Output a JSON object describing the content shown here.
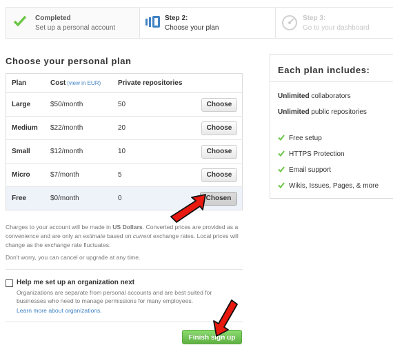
{
  "steps": [
    {
      "title": "Completed",
      "subtitle": "Set up a personal account",
      "icon": "check-icon"
    },
    {
      "title": "Step 2:",
      "subtitle": "Choose your plan",
      "icon": "book-icon"
    },
    {
      "title": "Step 3:",
      "subtitle": "Go to your dashboard",
      "icon": "dashboard-icon"
    }
  ],
  "plans": {
    "heading": "Choose your personal plan",
    "columns": {
      "plan": "Plan",
      "cost": "Cost",
      "view_eur": "(view in EUR)",
      "private": "Private repositories"
    },
    "rows": [
      {
        "name": "Large",
        "cost": "$50/month",
        "repos": "50",
        "button": "Choose"
      },
      {
        "name": "Medium",
        "cost": "$22/month",
        "repos": "20",
        "button": "Choose"
      },
      {
        "name": "Small",
        "cost": "$12/month",
        "repos": "10",
        "button": "Choose"
      },
      {
        "name": "Micro",
        "cost": "$7/month",
        "repos": "5",
        "button": "Choose"
      },
      {
        "name": "Free",
        "cost": "$0/month",
        "repos": "0",
        "button": "Chosen"
      }
    ],
    "selected": "Free"
  },
  "notes": {
    "p1_a": "Charges to your account will be made in ",
    "p1_b": "US Dollars",
    "p1_c": ". Converted prices are provided as a convenience and are only an ",
    "p1_d": "estimate",
    "p1_e": " based on ",
    "p1_f": "current",
    "p1_g": " exchange rates. Local prices will change as the exchange rate fluctuates.",
    "p2": "Don't worry, you can cancel or upgrade at any time."
  },
  "org": {
    "label": "Help me set up an organization next",
    "description": "Organizations are separate from personal accounts and are best suited for businesses who need to manage permissions for many employees.",
    "link": "Learn more about organizations.",
    "checked": false
  },
  "finish_button": "Finish sign up",
  "includes": {
    "heading": "Each plan includes:",
    "line1_bold": "Unlimited",
    "line1_rest": " collaborators",
    "line2_bold": "Unlimited",
    "line2_rest": " public repositories",
    "features": [
      "Free setup",
      "HTTPS Protection",
      "Email support",
      "Wikis, Issues, Pages, & more"
    ]
  },
  "colors": {
    "accent_green": "#60b044",
    "link_blue": "#4183c4",
    "arrow_red": "#e8190f"
  }
}
